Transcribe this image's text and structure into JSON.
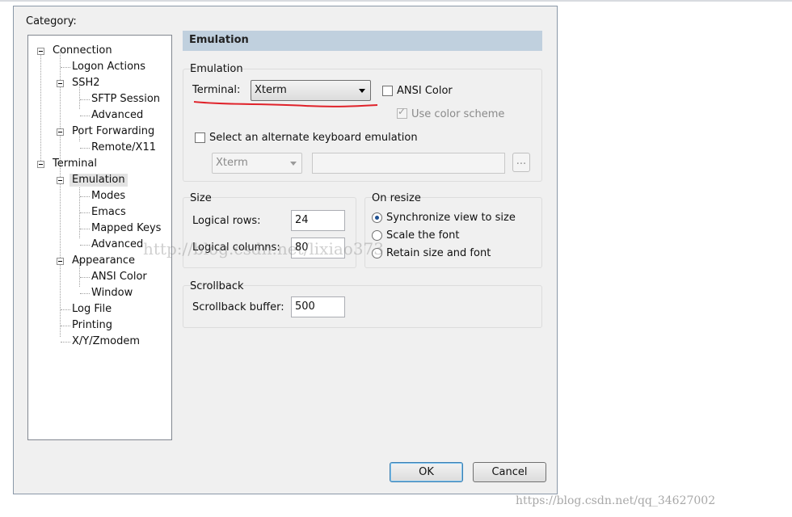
{
  "category_label": "Category:",
  "tree": {
    "connection": "Connection",
    "logon_actions": "Logon Actions",
    "ssh2": "SSH2",
    "sftp_session": "SFTP Session",
    "ssh2_advanced": "Advanced",
    "port_forwarding": "Port Forwarding",
    "remote_x11": "Remote/X11",
    "terminal": "Terminal",
    "emulation": "Emulation",
    "modes": "Modes",
    "emacs": "Emacs",
    "mapped_keys": "Mapped Keys",
    "emulation_advanced": "Advanced",
    "appearance": "Appearance",
    "ansi_color": "ANSI Color",
    "window": "Window",
    "log_file": "Log File",
    "printing": "Printing",
    "xyzmodem": "X/Y/Zmodem"
  },
  "panel_title": "Emulation",
  "emulation_group": {
    "label": "Emulation",
    "terminal_label": "Terminal:",
    "terminal_value": "Xterm",
    "ansi_color_label": "ANSI Color",
    "use_color_scheme_label": "Use color scheme",
    "alt_keyboard_label": "Select an alternate keyboard emulation",
    "alt_keyboard_value": "Xterm",
    "alt_keyboard_path": "",
    "browse_label": "..."
  },
  "size_group": {
    "label": "Size",
    "rows_label": "Logical rows:",
    "rows_value": "24",
    "cols_label": "Logical columns:",
    "cols_value": "80"
  },
  "resize_group": {
    "label": "On resize",
    "sync_label": "Synchronize view to size",
    "scale_label": "Scale the font",
    "retain_label": "Retain size and font"
  },
  "scrollback_group": {
    "label": "Scrollback",
    "buffer_label": "Scrollback buffer:",
    "buffer_value": "500"
  },
  "buttons": {
    "ok": "OK",
    "cancel": "Cancel"
  },
  "watermarks": {
    "center": "http://blog.csdn.net/lixiao373",
    "corner": "https://blog.csdn.net/qq_34627002"
  },
  "colors": {
    "header_bg": "#c0d0de",
    "annotation_underline": "#e0222a",
    "radio_selected": "#1d4f91"
  }
}
